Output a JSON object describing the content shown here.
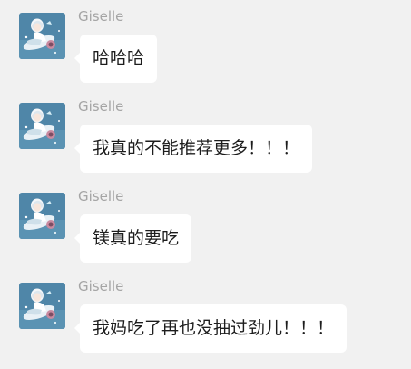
{
  "chat": {
    "messages": [
      {
        "sender": "Giselle",
        "text": "哈哈哈"
      },
      {
        "sender": "Giselle",
        "text": "我真的不能推荐更多！！！"
      },
      {
        "sender": "Giselle",
        "text": "镁真的要吃"
      },
      {
        "sender": "Giselle",
        "text": "我妈吃了再也没抽过劲儿！！！"
      }
    ]
  },
  "colors": {
    "background": "#f1f1f1",
    "bubble": "#ffffff",
    "sender_name": "#a5a5a5",
    "text": "#1d1d1d",
    "avatar_bg": "#4f86a8"
  },
  "icons": {
    "avatar": "anime-girl-floating-avatar"
  }
}
